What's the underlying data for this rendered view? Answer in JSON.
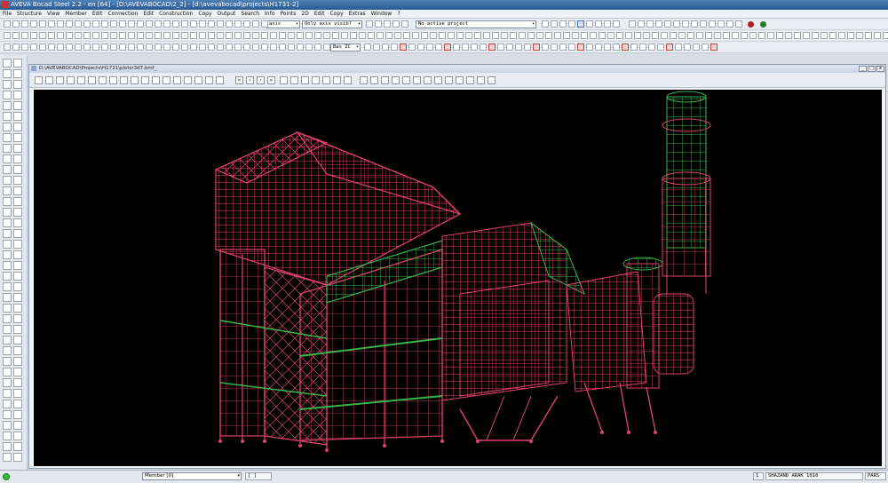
{
  "window": {
    "title": "AVEVA Bocad Steel 2.2 - en [64] - [D:\\AVEVABOCAD\\2_2] - [d:\\avevabocad\\projects\\H1731-2]"
  },
  "menu": [
    "File",
    "Structure",
    "View",
    "Member",
    "Edit",
    "Connection",
    "Edit",
    "Construction",
    "Copy",
    "Output",
    "Search",
    "Info",
    "Points",
    "2D",
    "Edit",
    "Copy",
    "Extras",
    "Window",
    "?"
  ],
  "toolbar": {
    "axis_combo": "axis",
    "axis_visibility_combo": "Only axis visib?",
    "project_combo": "No active project",
    "plane_combo": "Bas ZC"
  },
  "document": {
    "title": "D:\\AVEVABOCAD\\Projects\\H1731\\plotsr3d7.bmf_",
    "minimize_label": "_",
    "maximize_label": "□",
    "close_label": "x"
  },
  "status": {
    "member_combo": "Member [0]",
    "selection": "[ ]",
    "count": "1",
    "user": "SHAZAND ARAK 1010",
    "mode": "PARS"
  },
  "colors": {
    "steel": "#e0436a",
    "secondary": "#3bb34a",
    "background": "#000000"
  }
}
